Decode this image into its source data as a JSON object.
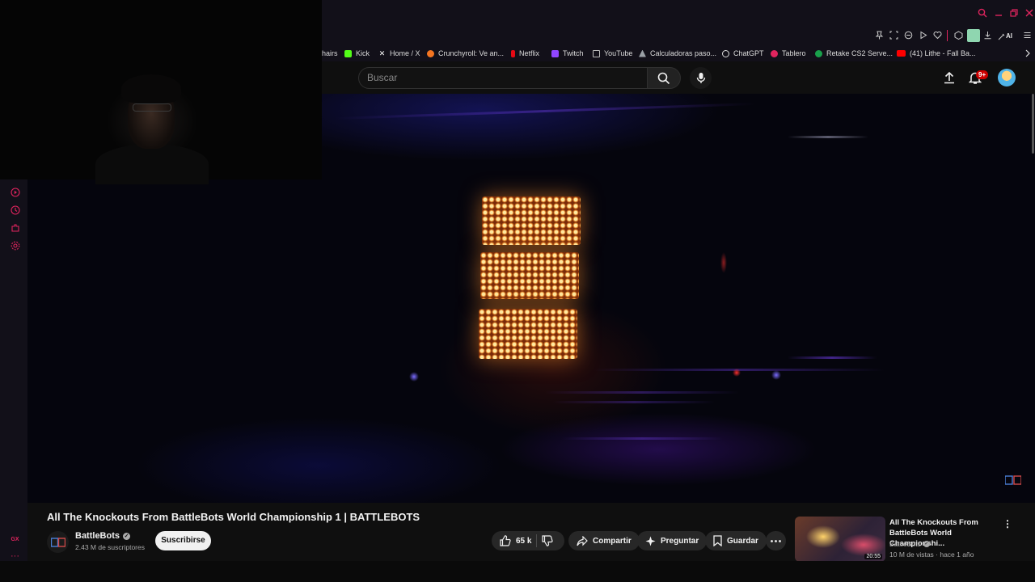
{
  "colors": {
    "gx_accent": "#e0245e",
    "youtube_red": "#cc0000",
    "page_bg": "#0f0f0f"
  },
  "browser": {
    "window_controls": [
      "search-icon",
      "minimize-icon",
      "restore-icon",
      "close-icon"
    ],
    "toolbar_icons": [
      "pin-icon",
      "snapshot-icon",
      "shield-icon",
      "play-icon",
      "heart-icon",
      "cube-icon",
      "extension-icon",
      "download-icon",
      "ai-icon",
      "menu-icon"
    ],
    "toolbar_ai_label": "AI",
    "bookmarks": [
      {
        "label": "hairs",
        "icon": "none"
      },
      {
        "label": "Kick",
        "icon": "kick-icon",
        "color": "#53fc18"
      },
      {
        "label": "Home / X",
        "icon": "x-icon",
        "color": "#ffffff"
      },
      {
        "label": "Crunchyroll: Ve an...",
        "icon": "crunchyroll-icon",
        "color": "#f47521"
      },
      {
        "label": "Netflix",
        "icon": "netflix-icon",
        "color": "#e50914"
      },
      {
        "label": "Twitch",
        "icon": "twitch-icon",
        "color": "#9146ff"
      },
      {
        "label": "YouTube",
        "icon": "page-icon",
        "color": "#bbbbbb"
      },
      {
        "label": "Calculadoras paso...",
        "icon": "calculator-icon",
        "color": "#9aa0a6"
      },
      {
        "label": "ChatGPT",
        "icon": "chatgpt-icon",
        "color": "#dddddd"
      },
      {
        "label": "Tablero",
        "icon": "dashboard-icon",
        "color": "#e0245e"
      },
      {
        "label": "Retake CS2 Serve...",
        "icon": "server-icon",
        "color": "#19a04b"
      },
      {
        "label": "(41) Lithe - Fall Ba...",
        "icon": "youtube-icon",
        "color": "#ff0000"
      }
    ],
    "bookmarks_overflow_icon": "chevron-right-icon"
  },
  "youtube": {
    "search_placeholder": "Buscar",
    "notification_count": "9+",
    "video": {
      "title": "All The Knockouts From BattleBots World Championship 1 | BATTLEBOTS",
      "channel": "BattleBots",
      "subscribers": "2.43 M de suscriptores",
      "subscribe_label": "Suscribirse",
      "likes": "65 k",
      "share_label": "Compartir",
      "ask_label": "Preguntar",
      "save_label": "Guardar"
    },
    "related": {
      "title": "All The Knockouts From BattleBots World Championshi...",
      "channel": "BattleBots",
      "meta": "10 M de vistas · hace 1 año",
      "duration": "20:55"
    }
  }
}
